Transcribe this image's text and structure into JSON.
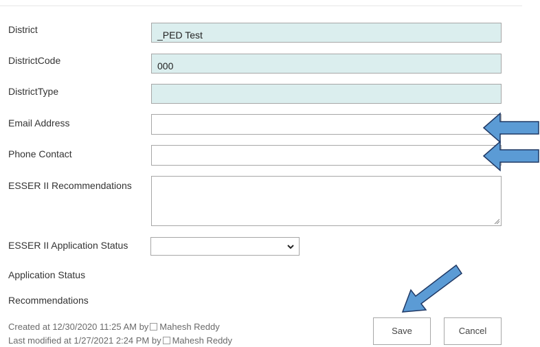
{
  "form": {
    "fields": [
      {
        "label": "District",
        "value": "_PED Test"
      },
      {
        "label": "DistrictCode",
        "value": "000"
      },
      {
        "label": "DistrictType",
        "value": ""
      },
      {
        "label": "Email Address",
        "value": ""
      },
      {
        "label": "Phone Contact",
        "value": ""
      },
      {
        "label": "ESSER II Recommendations",
        "value": ""
      },
      {
        "label": "ESSER II Application Status",
        "value": ""
      },
      {
        "label": "Application Status"
      },
      {
        "label": "Recommendations"
      }
    ]
  },
  "footer": {
    "created_prefix": "Created at 12/30/2020 11:25 AM  by",
    "created_by": "Mahesh Reddy",
    "modified_prefix": "Last modified at 1/27/2021 2:24 PM  by",
    "modified_by": "Mahesh Reddy",
    "save_label": "Save",
    "cancel_label": "Cancel"
  },
  "colors": {
    "readonly_bg": "#dbeeee",
    "arrow_fill": "#5b9bd5",
    "arrow_stroke": "#1f3864"
  }
}
